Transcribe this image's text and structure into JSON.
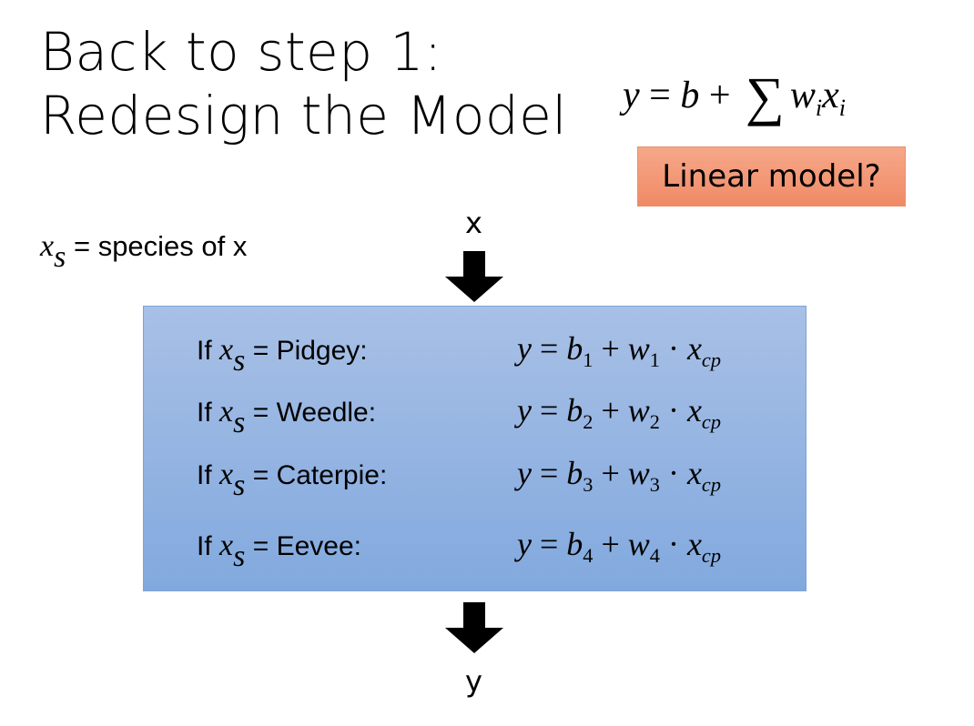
{
  "title": {
    "line1": "Back to step 1:",
    "line2": "Redesign the Model"
  },
  "formula": {
    "lhs": "y",
    "op_eq": "=",
    "b": "b",
    "op_plus": "+",
    "sum": "∑",
    "w": "w",
    "wi": "i",
    "x": "x",
    "xi": "i"
  },
  "badge": "Linear model?",
  "definition": {
    "var": "x",
    "sub": "s",
    "eq": "=",
    "text": "species of x"
  },
  "input_label": "x",
  "output_label": "y",
  "rows": [
    {
      "prefix": "If",
      "var": "x",
      "sub": "s",
      "eq": "=",
      "species": "Pidgey:",
      "y": "y",
      "op_eq": "=",
      "b": "b",
      "bi": "1",
      "plus": "+",
      "w": "w",
      "wi": "1",
      "dot": "·",
      "x": "x",
      "xsub": "cp"
    },
    {
      "prefix": "If",
      "var": "x",
      "sub": "s",
      "eq": "=",
      "species": "Weedle:",
      "y": "y",
      "op_eq": "=",
      "b": "b",
      "bi": "2",
      "plus": "+",
      "w": "w",
      "wi": "2",
      "dot": "·",
      "x": "x",
      "xsub": "cp"
    },
    {
      "prefix": "If",
      "var": "x",
      "sub": "s",
      "eq": "=",
      "species": "Caterpie:",
      "y": "y",
      "op_eq": "=",
      "b": "b",
      "bi": "3",
      "plus": "+",
      "w": "w",
      "wi": "3",
      "dot": "·",
      "x": "x",
      "xsub": "cp"
    },
    {
      "prefix": "If",
      "var": "x",
      "sub": "s",
      "eq": "=",
      "species": "Eevee:",
      "y": "y",
      "op_eq": "=",
      "b": "b",
      "bi": "4",
      "plus": "+",
      "w": "w",
      "wi": "4",
      "dot": "·",
      "x": "x",
      "xsub": "cp"
    }
  ],
  "colors": {
    "box_top": "#a8c0e6",
    "box_bottom": "#82a9de",
    "badge_top": "#f6a889",
    "badge_bottom": "#f08a66",
    "arrow": "#000000"
  }
}
